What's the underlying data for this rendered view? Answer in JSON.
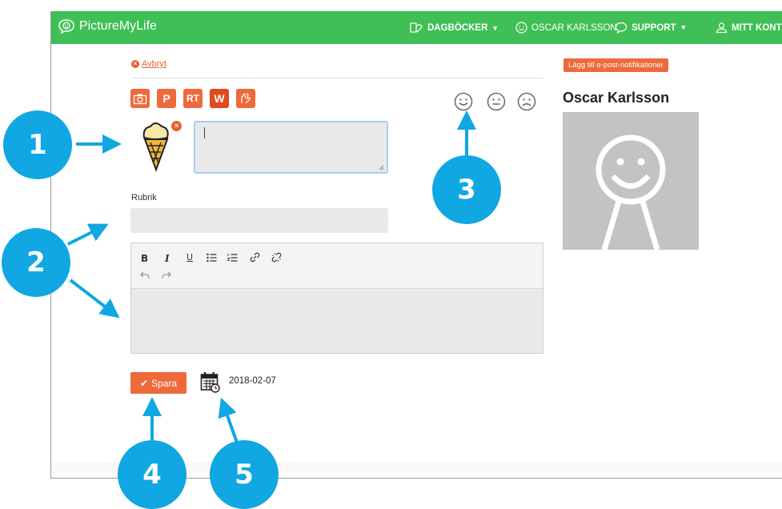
{
  "navbar": {
    "brand": "PictureMyLife",
    "menu": [
      {
        "label": "DAGBÖCKER",
        "icon": "diary-icon",
        "has_dropdown": true
      },
      {
        "label": "OSCAR KARLSSON",
        "icon": "smiley-icon",
        "has_dropdown": false
      },
      {
        "label": "SUPPORT",
        "icon": "speech-bubble-icon",
        "has_dropdown": true
      },
      {
        "label": "MITT KONT",
        "icon": "user-icon",
        "has_dropdown": false
      }
    ]
  },
  "editor": {
    "cancel_label": "Avbryt",
    "media_buttons": [
      {
        "name": "camera",
        "label": ""
      },
      {
        "name": "pictogram",
        "label": "P"
      },
      {
        "name": "rt",
        "label": "RT"
      },
      {
        "name": "widgit",
        "label": "W"
      },
      {
        "name": "sign",
        "label": ""
      }
    ],
    "moods": [
      "happy",
      "neutral",
      "sad"
    ],
    "caption_value": "",
    "rubrik_label": "Rubrik",
    "rubrik_value": "",
    "text_value": "",
    "save_label": "Spara",
    "date": "2018-02-07"
  },
  "sidebar": {
    "notification_button": "Lägg till e-post-notifikationer",
    "profile_name": "Oscar Karlsson"
  },
  "callouts": [
    "1",
    "2",
    "3",
    "4",
    "5"
  ],
  "colors": {
    "navbar": "#3fbf55",
    "accent": "#ee6a3b",
    "callout": "#10a7e2"
  }
}
